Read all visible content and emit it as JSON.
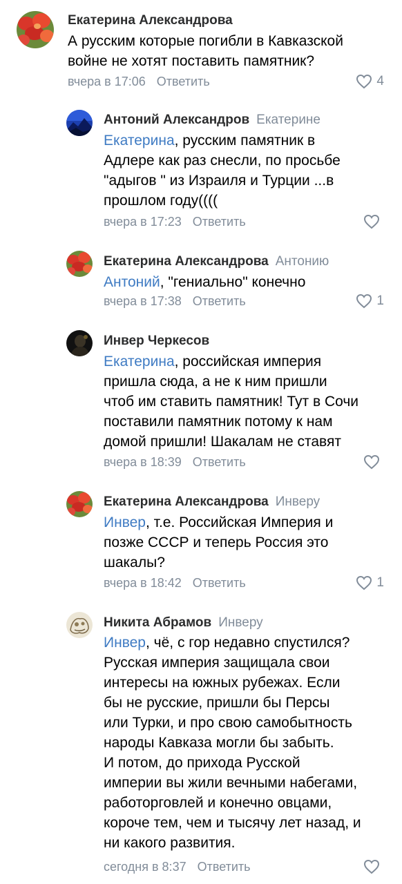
{
  "comments": [
    {
      "author": "Екатерина Александрова",
      "reply_to": "",
      "mention": "",
      "text": "А русским которые погибли в Кавказской\nвойне не хотят поставить памятник?",
      "time": "вчера в 17:06",
      "reply_label": "Ответить",
      "likes": "4",
      "avatar": "tulip-avatar"
    },
    {
      "author": "Антоний Александров",
      "reply_to": "Екатерине",
      "mention": "Екатерина",
      "text": ", русским памятник в\nАдлере как раз снесли, по просьбе\n\"адыгов \" из Израиля и Турции  ...в\nпрошлом году((((",
      "time": "вчера в 17:23",
      "reply_label": "Ответить",
      "likes": "",
      "avatar": "mountain-avatar"
    },
    {
      "author": "Екатерина Александрова",
      "reply_to": "Антонию",
      "mention": "Антоний",
      "text": ", \"гениально\" конечно",
      "time": "вчера в 17:38",
      "reply_label": "Ответить",
      "likes": "1",
      "avatar": "tulip-avatar"
    },
    {
      "author": "Инвер Черкесов",
      "reply_to": "",
      "mention": "Екатерина",
      "text": ", российская империя\nпришла сюда, а не к ним пришли\nчтоб им ставить памятник! Тут в Сочи\nпоставили памятник потому к нам\nдомой пришли! Шакалам не ставят",
      "time": "вчера в 18:39",
      "reply_label": "Ответить",
      "likes": "",
      "avatar": "dark-avatar"
    },
    {
      "author": "Екатерина Александрова",
      "reply_to": "Инверу",
      "mention": "Инвер",
      "text": ", т.е. Российская Империя и\nпозже СССР и теперь Россия это\nшакалы?",
      "time": "вчера в 18:42",
      "reply_label": "Ответить",
      "likes": "1",
      "avatar": "tulip-avatar"
    },
    {
      "author": "Никита Абрамов",
      "reply_to": "Инверу",
      "mention": "Инвер",
      "text": ", чё, с гор недавно спустился?\nРусская империя защищала свои\nинтересы на южных рубежах. Если\nбы не русские, пришли бы Персы\nили Турки, и про свою самобытность\nнароды Кавказа могли бы забыть.\nИ потом, до прихода Русской\nимперии вы жили вечными набегами,\nработорговлей и конечно овцами,\nкороче тем, чем и тысячу лет назад, и\nни какого развития.",
      "time": "сегодня в 8:37",
      "reply_label": "Ответить",
      "likes": "",
      "avatar": "sketch-avatar"
    }
  ],
  "colors": {
    "author": "#2c2d2e",
    "secondary": "#818c99",
    "mention": "#3f7bc3"
  }
}
